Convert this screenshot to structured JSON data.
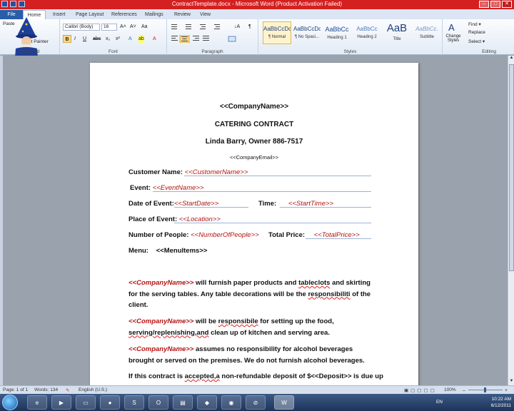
{
  "window": {
    "title": "ContractTemplate.docx  -  Microsoft Word (Product Activation Failed)",
    "minimize": "–",
    "maximize": "□",
    "close": "✕"
  },
  "tabs": [
    {
      "label": "File"
    },
    {
      "label": "Home"
    },
    {
      "label": "Insert"
    },
    {
      "label": "Page Layout"
    },
    {
      "label": "References"
    },
    {
      "label": "Mailings"
    },
    {
      "label": "Review"
    },
    {
      "label": "View"
    }
  ],
  "ribbon": {
    "clipboard": {
      "label": "Clipboard",
      "paste": "Paste",
      "format_painter": "at Painter"
    },
    "font": {
      "label": "Font",
      "name": "Calibri (Body)",
      "size": "16",
      "grow": "A˄",
      "shrink": "A˅",
      "case": "Aa",
      "bold": "B",
      "italic": "I",
      "underline": "U",
      "strike": "abc",
      "sub": "x₂",
      "sup": "x²",
      "text_effects": "A",
      "highlight": "ab",
      "font_color": "A"
    },
    "paragraph": {
      "label": "Paragraph",
      "pilcrow": "¶",
      "sort": "↓A"
    },
    "styles": {
      "label": "Styles",
      "items": [
        {
          "sample": "AaBbCcDc",
          "name": "¶ Normal"
        },
        {
          "sample": "AaBbCcDc",
          "name": "¶ No Spaci..."
        },
        {
          "sample": "AaBbCc",
          "name": "Heading 1"
        },
        {
          "sample": "AaBbCc",
          "name": "Heading 2"
        },
        {
          "sample": "AaB",
          "name": "Title"
        },
        {
          "sample": "AaBbCc.",
          "name": "Subtitle"
        }
      ],
      "change": "Change Styles"
    },
    "editing": {
      "label": "Editing",
      "find": "Find ▾",
      "replace": "Replace",
      "select": "Select ▾"
    }
  },
  "document": {
    "company_placeholder": "<<CompanyName>>",
    "contract_title": "CATERING CONTRACT",
    "owner_line": "Linda Barry, Owner  886-7517",
    "email_placeholder": "<<CompanyEmail>>",
    "customer_label": "Customer Name:",
    "customer_field": "<<CustomerName>>",
    "event_label": "Event:",
    "event_field": "<<EventName>>",
    "date_label": "Date of Event:",
    "date_field": "<<StartDate>>",
    "time_label": "Time:",
    "time_field": "<<StartTime>>",
    "place_label": "Place of Event:",
    "place_field": "<<Location>>",
    "people_label": "Number of People:",
    "people_field": "<<NumberOfPeople>>",
    "price_label": "Total Price:",
    "price_field": "<<TotalPrice>>",
    "menu_label": "Menu:",
    "menu_field": "<<MenuItems>>",
    "para1_field": "<<CompanyName>>",
    "para1_a": "  will furnish paper products and ",
    "para1_b": "tableclots",
    "para1_c": " and skirting for the serving tables. Any table decorations will be the ",
    "para1_d": "responsibiliti",
    "para1_e": " of the client.",
    "para2_field": "<<CompanyName>>",
    "para2_a": "   will be ",
    "para2_b": "responsibile",
    "para2_c": " for setting up the food, ",
    "para2_d": "serving/replenishing,and",
    "para2_e": " clean up of kitchen and serving area.",
    "para3_field": "<<CompanyName>>",
    "para3_a": "   assumes no responsibility for alcohol beverages brought or served on the premises. We do not furnish alcohol beverages.",
    "para4_a": "If this contract is ",
    "para4_b": "accepted,a",
    "para4_c": " non-refundable deposit of $<<Deposit>> is due up"
  },
  "status": {
    "page": "Page: 1 of 1",
    "words": "Words: 134",
    "language": "English (U.S.)",
    "zoom": "100%"
  },
  "taskbar": {
    "lang": "EN",
    "time": "10:22 AM",
    "date": "6/12/2011",
    "word_icon": "W"
  }
}
